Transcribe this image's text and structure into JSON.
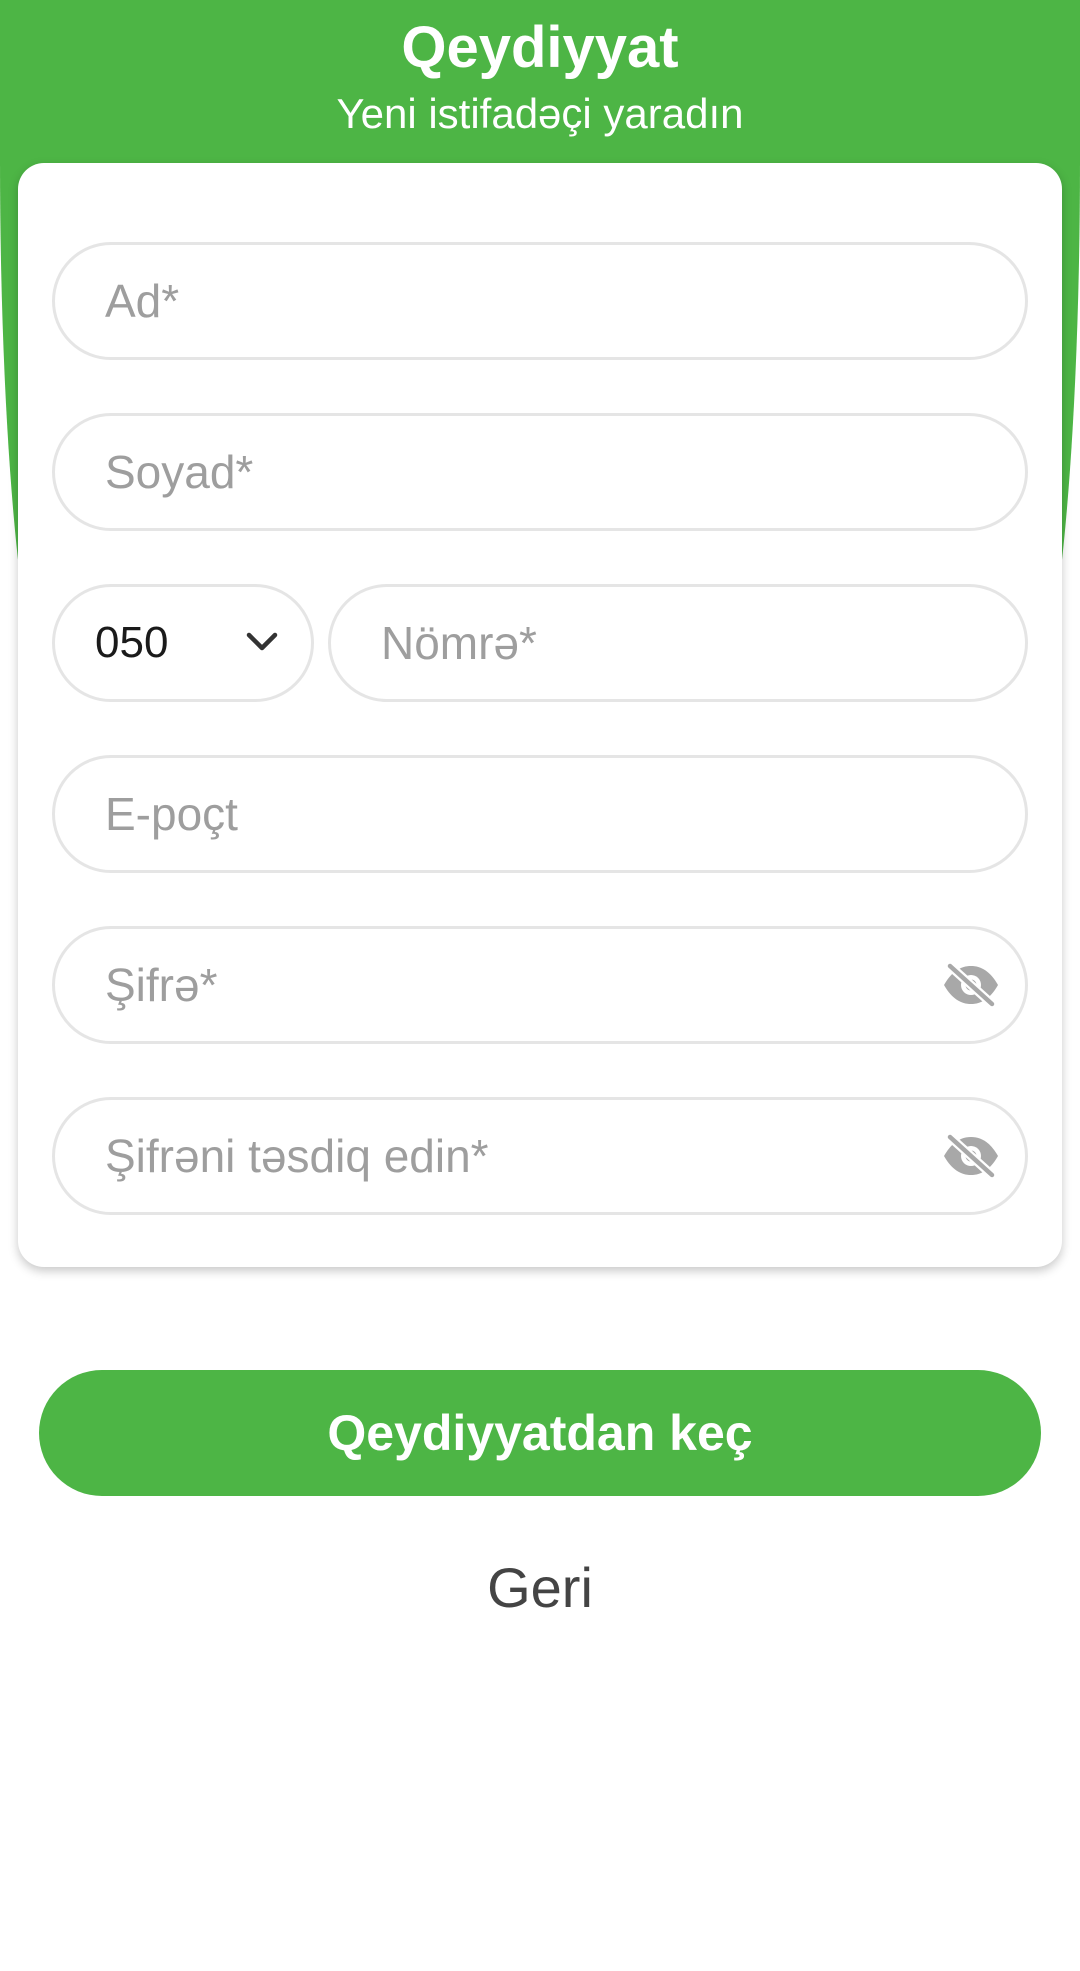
{
  "header": {
    "title": "Qeydiyyat",
    "subtitle": "Yeni istifadəçi yaradın"
  },
  "form": {
    "first_name_placeholder": "Ad*",
    "last_name_placeholder": "Soyad*",
    "phone_prefix_value": "050",
    "phone_number_placeholder": "Nömrə*",
    "email_placeholder": "E-poçt",
    "password_placeholder": "Şifrə*",
    "confirm_password_placeholder": "Şifrəni təsdiq edin*"
  },
  "actions": {
    "submit_label": "Qeydiyyatdan keç",
    "back_label": "Geri"
  },
  "icons": {
    "prefix_dropdown": "chevron-down-icon",
    "password_toggle": "eye-off-icon"
  },
  "colors": {
    "brand_green": "#4db545",
    "placeholder_gray": "#9e9e9e",
    "field_border": "#e5e5e5"
  }
}
